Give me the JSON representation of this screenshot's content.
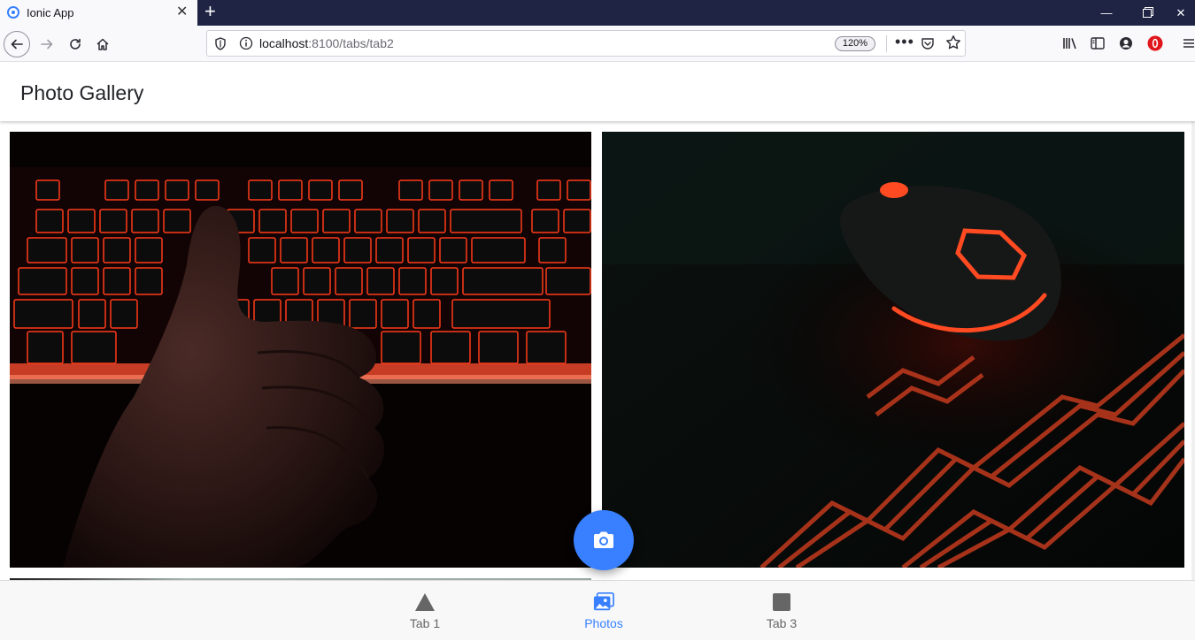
{
  "browser": {
    "tab_title": "Ionic App",
    "tab_close": "✕",
    "new_tab": "+",
    "url_host": "localhost",
    "url_path": ":8100/tabs/tab2",
    "zoom": "120%",
    "more_actions": "•••",
    "window_min": "—",
    "window_close": "✕"
  },
  "app": {
    "title": "Photo Gallery",
    "photos": [
      {
        "alt": "keyboard-photo"
      },
      {
        "alt": "mouse-photo"
      }
    ]
  },
  "tabs": [
    {
      "label": "Tab 1",
      "icon": "triangle-icon",
      "selected": false
    },
    {
      "label": "Photos",
      "icon": "images-icon",
      "selected": true
    },
    {
      "label": "Tab 3",
      "icon": "square-icon",
      "selected": false
    }
  ],
  "colors": {
    "primary": "#3880ff",
    "browser_titlebar": "#1f2445",
    "tab_inactive": "#666666"
  }
}
